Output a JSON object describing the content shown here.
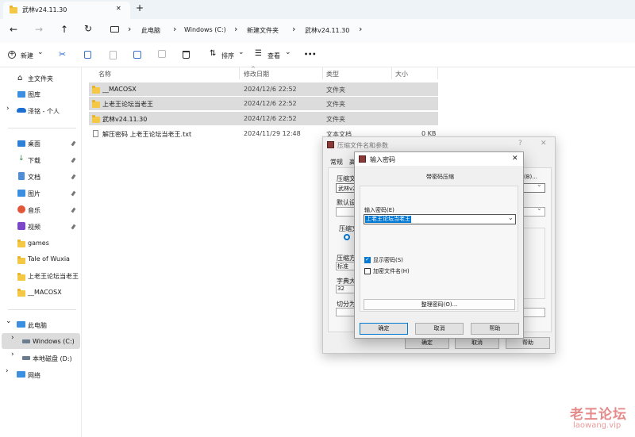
{
  "tab": {
    "title": "武林v24.11.30",
    "close": "✕",
    "add": "+"
  },
  "nav": {
    "back": "←",
    "forward": "→",
    "up": "↑",
    "refresh": "↻",
    "crumbs": [
      "此电脑",
      "Windows (C:)",
      "新建文件夹",
      "武林v24.11.30"
    ],
    "sep": "›"
  },
  "toolbar": {
    "new": "新建",
    "sort": "排序",
    "view": "查看",
    "more": "•••",
    "chev": "⌄"
  },
  "sidebar": {
    "top": [
      "主文件夹",
      "图库",
      "泽铭 - 个人"
    ],
    "quick": [
      "桌面",
      "下载",
      "文档",
      "图片",
      "音乐",
      "视频",
      "games",
      "Tale of Wuxia",
      "上老王论坛当老王",
      "__MACOSX"
    ],
    "pc": "此电脑",
    "drives": [
      "Windows (C:)",
      "本地磁盘 (D:)"
    ],
    "net": "网络",
    "pin": "📌",
    "caret": "›",
    "caret_open": "⌄"
  },
  "columns": {
    "name": "名称",
    "date": "修改日期",
    "type": "类型",
    "size": "大小",
    "sort_arrow": "^"
  },
  "files": [
    {
      "name": "__MACOSX",
      "date": "2024/12/6 22:52",
      "type": "文件夹",
      "size": ""
    },
    {
      "name": "上老王论坛当老王",
      "date": "2024/12/6 22:52",
      "type": "文件夹",
      "size": ""
    },
    {
      "name": "武林v24.11.30",
      "date": "2024/12/6 22:52",
      "type": "文件夹",
      "size": ""
    },
    {
      "name": "解压密码 上老王论坛当老王.txt",
      "date": "2024/11/29 12:48",
      "type": "文本文档",
      "size": "0 KB"
    }
  ],
  "dlg1": {
    "title": "压缩文件名和参数",
    "help": "?",
    "close": "✕",
    "tabs": [
      "常规",
      "高"
    ],
    "labels": [
      "压缩文",
      "默认设",
      "压缩文",
      "压缩方",
      "字典大",
      "切分为"
    ],
    "field1": "武林v2",
    "browse": "(B)...",
    "method": "标准",
    "dict": "32",
    "ok": "确定",
    "cancel": "取消",
    "helpbtn": "帮助",
    "drop": "⌄"
  },
  "dlg2": {
    "title": "输入密码",
    "close": "✕",
    "subtitle": "带密码压缩",
    "label": "输入密码(E)",
    "password": "上老王论坛当老王",
    "show": "显示密码(S)",
    "encrypt": "加密文件名(H)",
    "organize": "整理密码(O)...",
    "ok": "确定",
    "cancel": "取消",
    "help": "帮助",
    "drop": "⌄",
    "check": "✓"
  },
  "watermark": {
    "cn": "老王论坛",
    "url": "laowang.vip"
  },
  "colors": {
    "accent": "#0078d4",
    "watermark": "#e48a8a",
    "selection": "#dcdcdc"
  }
}
